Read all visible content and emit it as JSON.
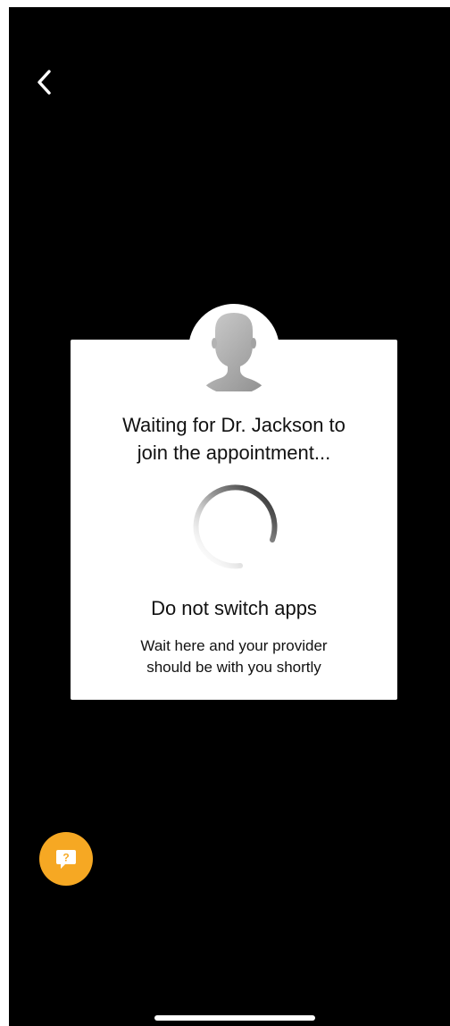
{
  "navigation": {
    "back_icon": "chevron-left-icon"
  },
  "waiting_card": {
    "avatar_icon": "person-silhouette-icon",
    "title_line1": "Waiting for Dr. Jackson to",
    "title_line2": "join the appointment...",
    "spinner_icon": "loading-spinner-icon",
    "heading": "Do not switch apps",
    "message_line1": "Wait here and your provider",
    "message_line2": "should be with you shortly"
  },
  "help": {
    "icon": "question-chat-bubble-icon",
    "glyph": "?"
  },
  "colors": {
    "background": "#000000",
    "card": "#ffffff",
    "text": "#111111",
    "help_button": "#f6a823",
    "spinner": "#222222"
  }
}
